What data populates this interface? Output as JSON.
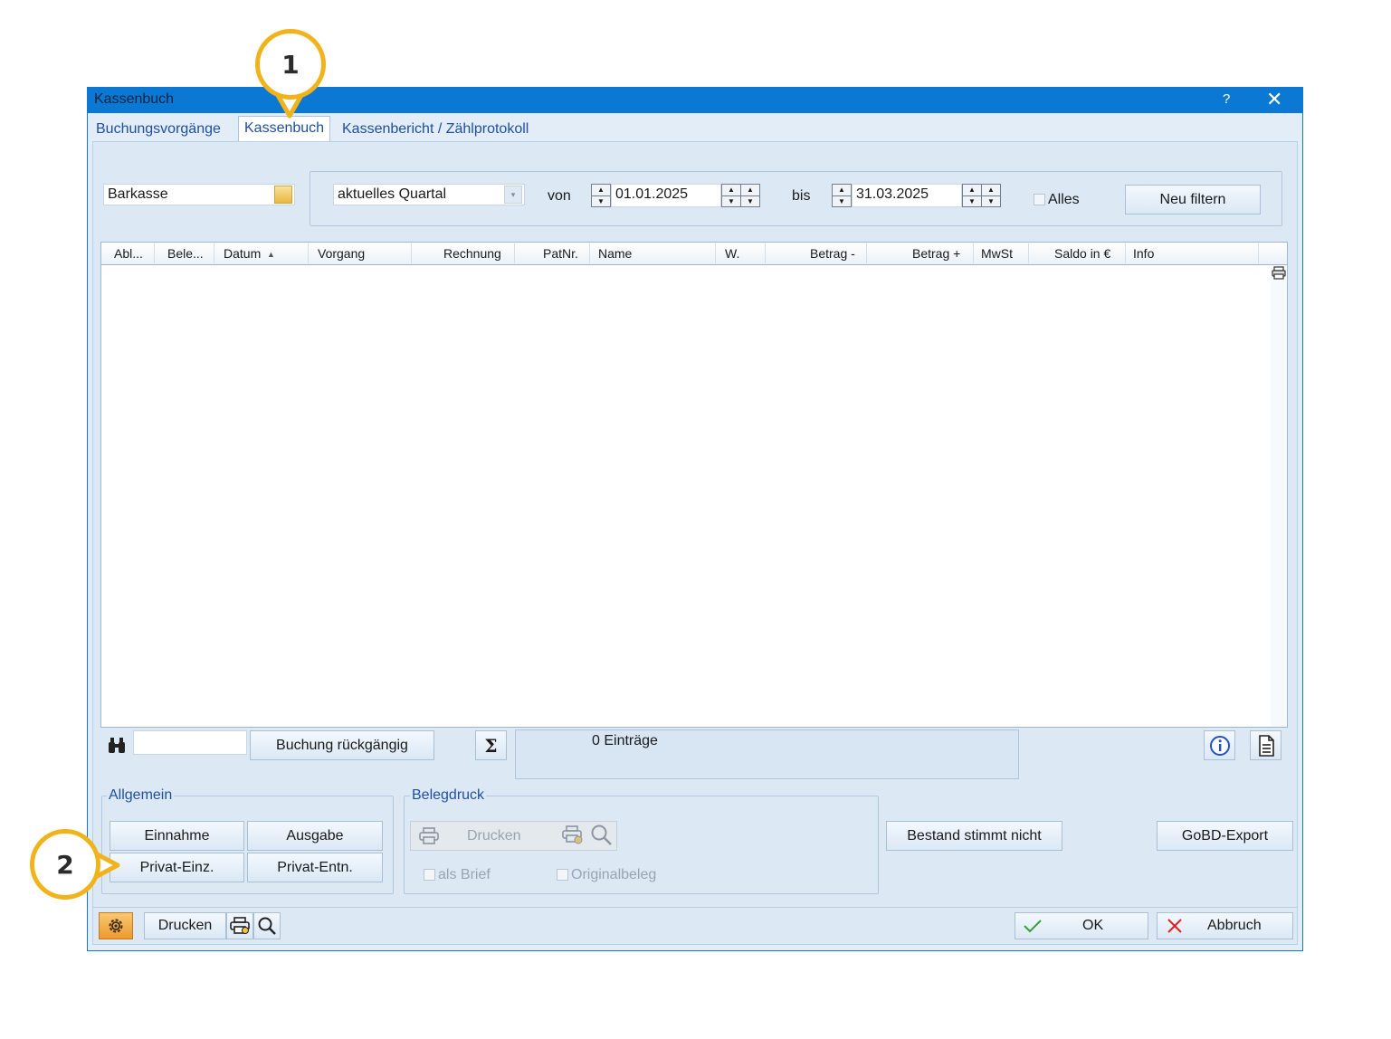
{
  "window": {
    "title": "Kassenbuch",
    "help": "?",
    "close": "✕"
  },
  "tabs": [
    "Buchungsvorgänge",
    "Kassenbuch",
    "Kassenbericht / Zählprotokoll"
  ],
  "filter": {
    "kasse": "Barkasse",
    "zeitraum": "aktuelles Quartal",
    "von_label": "von",
    "von": "01.01.2025",
    "bis_label": "bis",
    "bis": "31.03.2025",
    "alles_label": "Alles",
    "neu_filtern": "Neu filtern"
  },
  "table": {
    "columns": [
      "Abl...",
      "Bele...",
      "Datum",
      "Vorgang",
      "Rechnung",
      "PatNr.",
      "Name",
      "W.",
      "Betrag -",
      "Betrag +",
      "MwSt",
      "Saldo in €",
      "Info"
    ]
  },
  "toolbar": {
    "search_value": "",
    "undo": "Buchung rückgängig",
    "sigma": "Σ",
    "count": "0 Einträge"
  },
  "allgemein": {
    "legend": "Allgemein",
    "einnahme": "Einnahme",
    "ausgabe": "Ausgabe",
    "privat_einz": "Privat-Einz.",
    "privat_entn": "Privat-Entn."
  },
  "belegdruck": {
    "legend": "Belegdruck",
    "drucken": "Drucken",
    "als_brief": "als Brief",
    "originalbeleg": "Originalbeleg"
  },
  "actions": {
    "bestand": "Bestand stimmt nicht",
    "gobd": "GoBD-Export",
    "drucken": "Drucken",
    "ok": "OK",
    "abbruch": "Abbruch"
  },
  "callouts": [
    "1",
    "2"
  ],
  "colors": {
    "titlebar": "#0b78d3",
    "callout": "#f1b31c",
    "tab_text": "#1f4fa0"
  }
}
